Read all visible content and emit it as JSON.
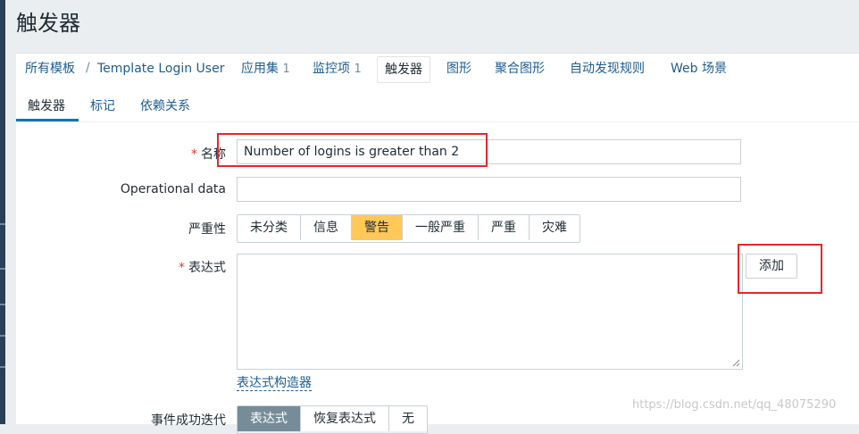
{
  "page_title": "触发器",
  "nav": {
    "items": [
      {
        "label": "所有模板"
      },
      {
        "label": "Template Login User"
      },
      {
        "label": "应用集",
        "count": "1"
      },
      {
        "label": "监控项",
        "count": "1"
      },
      {
        "label": "触发器",
        "active": true
      },
      {
        "label": "图形"
      },
      {
        "label": "聚合图形"
      },
      {
        "label": "自动发现规则"
      },
      {
        "label": "Web 场景"
      }
    ],
    "separator": "/"
  },
  "tabs": [
    {
      "label": "触发器",
      "active": true
    },
    {
      "label": "标记"
    },
    {
      "label": "依赖关系"
    }
  ],
  "form": {
    "required_mark": "*",
    "name_label": "名称",
    "name_value": "Number of logins is greater than 2",
    "opdata_label": "Operational data",
    "opdata_value": "",
    "severity_label": "严重性",
    "severity_options": [
      "未分类",
      "信息",
      "警告",
      "一般严重",
      "严重",
      "灾难"
    ],
    "severity_selected": "警告",
    "expression_label": "表达式",
    "expression_value": "",
    "add_button": "添加",
    "expression_builder_link": "表达式构造器",
    "event_gen_label": "事件成功迭代",
    "event_gen_options": [
      "表达式",
      "恢复表达式",
      "无"
    ],
    "event_gen_selected": "表达式"
  },
  "colors": {
    "accent_link": "#1f5c8f",
    "severity_warning": "#ffc859",
    "annotation_red": "#e8262a",
    "selected_gray": "#768d99"
  },
  "watermark": "https://blog.csdn.net/qq_48075290"
}
